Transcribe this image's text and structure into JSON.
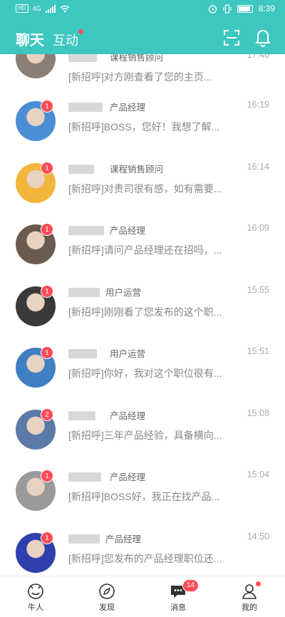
{
  "status_bar": {
    "left_icons": [
      "HD",
      "4G",
      "wifi-icon"
    ],
    "time": "8:39"
  },
  "header": {
    "tab_chat": "聊天",
    "tab_interact": "互动",
    "colors": {
      "bg": "#3ec6c0",
      "badge": "#ff4b57"
    },
    "icons": [
      "scan-icon",
      "bell-icon"
    ]
  },
  "conversations": [
    {
      "badge": "3",
      "position": "课程销售顾问",
      "time": "17:46",
      "message": "[新招呼]对方刚查看了您的主页...",
      "avatar_color": "#8a7f76"
    },
    {
      "badge": "1",
      "position": "产品经理",
      "time": "16:19",
      "message": "[新招呼]BOSS，您好！我想了解...",
      "avatar_color": "#4a8fd6"
    },
    {
      "badge": "1",
      "position": "课程销售顾问",
      "time": "16:14",
      "message": "[新招呼]对贵司很有感，如有需要...",
      "avatar_color": "#f2b63c"
    },
    {
      "badge": "1",
      "position": "产品经理",
      "time": "16:09",
      "message": "[新招呼]请问产品经理还在招吗，...",
      "avatar_color": "#6b5a50"
    },
    {
      "badge": "1",
      "position": "用户运营",
      "time": "15:55",
      "message": "[新招呼]刚刚看了您发布的这个职...",
      "avatar_color": "#3a3a3a"
    },
    {
      "badge": "1",
      "position": "用户运营",
      "time": "15:51",
      "message": "[新招呼]你好，我对这个职位很有...",
      "avatar_color": "#3f7fc2"
    },
    {
      "badge": "2",
      "position": "产品经理",
      "time": "15:08",
      "message": "[新招呼]三年产品经验，具备横向...",
      "avatar_color": "#5c7aa8"
    },
    {
      "badge": "1",
      "position": "产品经理",
      "time": "15:04",
      "message": "[新招呼]BOSS好，我正在找产品...",
      "avatar_color": "#9a9a9a"
    },
    {
      "badge": "1",
      "position": "产品经理",
      "time": "14:50",
      "message": "[新招呼]您发布的产品经理职位还...",
      "avatar_color": "#2f3fae"
    }
  ],
  "bottom_nav": [
    {
      "label": "牛人",
      "icon": "talent-icon"
    },
    {
      "label": "发现",
      "icon": "compass-icon"
    },
    {
      "label": "消息",
      "icon": "message-icon",
      "badge": "14"
    },
    {
      "label": "我的",
      "icon": "profile-icon",
      "dot": true
    }
  ]
}
